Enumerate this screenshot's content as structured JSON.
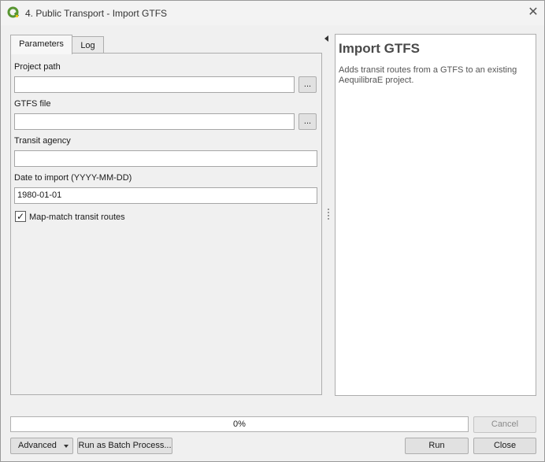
{
  "window": {
    "title": "4. Public Transport - Import GTFS",
    "close_glyph": "✕"
  },
  "tabs": [
    {
      "label": "Parameters",
      "active": true
    },
    {
      "label": "Log",
      "active": false
    }
  ],
  "params": {
    "project_path": {
      "label": "Project path",
      "value": "",
      "browse_label": "..."
    },
    "gtfs_file": {
      "label": "GTFS file",
      "value": "",
      "browse_label": "..."
    },
    "transit_agency": {
      "label": "Transit agency",
      "value": ""
    },
    "date_to_import": {
      "label": "Date to import (YYYY-MM-DD)",
      "value": "1980-01-01"
    },
    "map_match": {
      "label": "Map-match transit routes",
      "checked": true,
      "check_glyph": "✓"
    }
  },
  "help": {
    "title": "Import GTFS",
    "description": "Adds transit routes from a GTFS to an existing AequilibraE project."
  },
  "progress": {
    "text": "0%",
    "value": 0
  },
  "buttons": {
    "cancel": "Cancel",
    "advanced": "Advanced",
    "batch": "Run as Batch Process...",
    "run": "Run",
    "close": "Close"
  },
  "icons": {
    "app": "qgis-logo-icon",
    "close": "close-icon",
    "splitter": "collapse-arrow-icon",
    "dropdown": "chevron-down-icon"
  },
  "colors": {
    "qgis_green": "#589632",
    "qgis_yellow": "#ee7913"
  }
}
